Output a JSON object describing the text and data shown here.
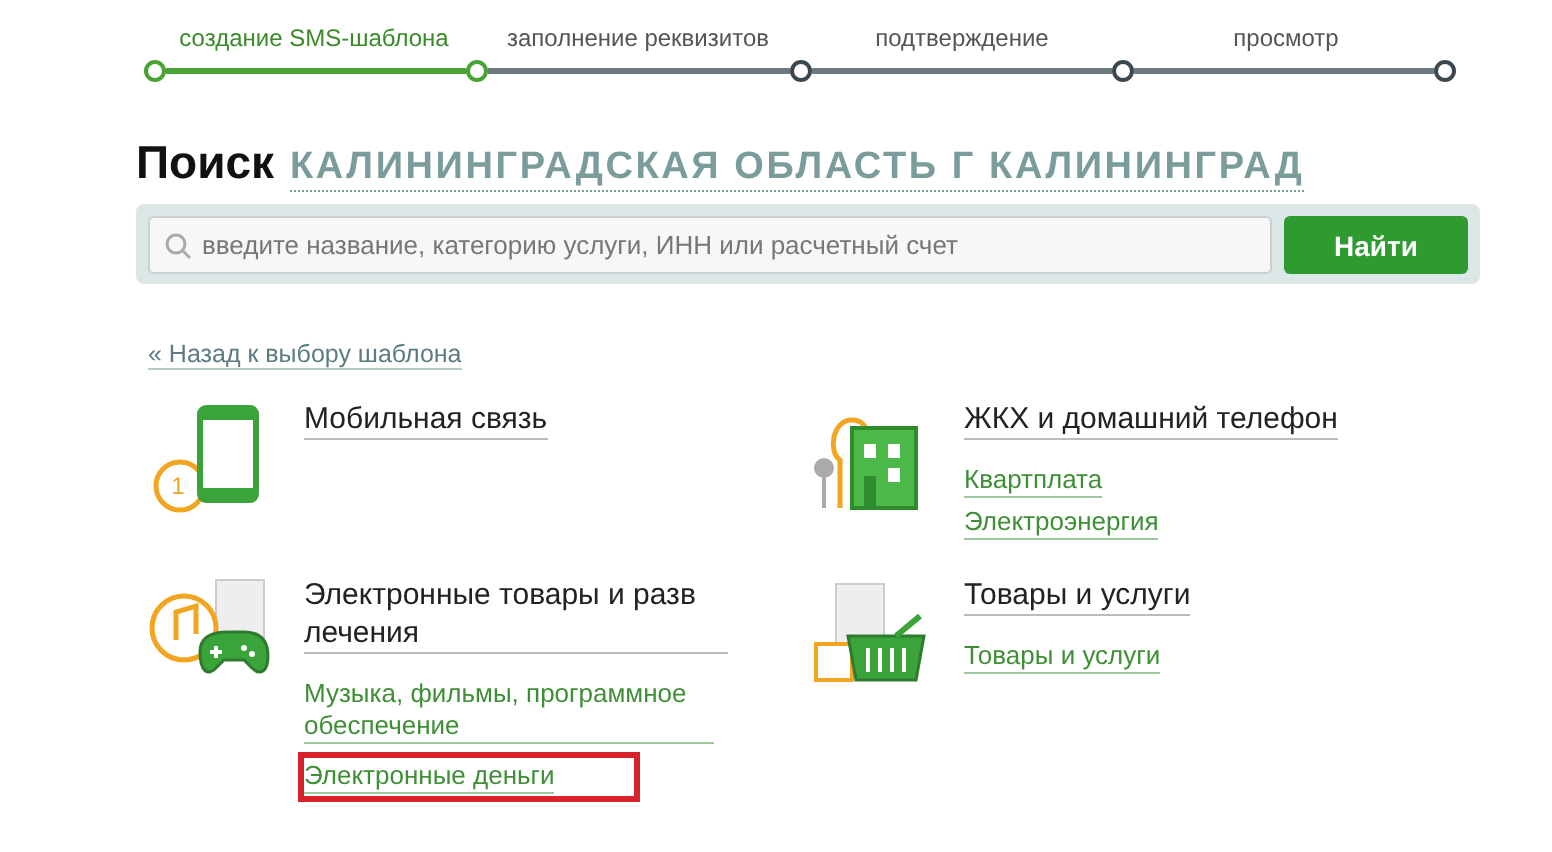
{
  "steps": [
    {
      "label": "создание SMS-шаблона",
      "done": true
    },
    {
      "label": "заполнение реквизитов",
      "done": false
    },
    {
      "label": "подтверждение",
      "done": false
    },
    {
      "label": "просмотр",
      "done": false
    }
  ],
  "search": {
    "title": "Поиск",
    "region": "КАЛИНИНГРАДСКАЯ ОБЛАСТЬ Г КАЛИНИНГРАД",
    "placeholder": "введите название, категорию услуги, ИНН или расчетный счет",
    "button": "Найти"
  },
  "back_link": "« Назад к выбору шаблона",
  "categories": [
    {
      "kind": "mobile",
      "title": "Мобильная связь",
      "badge": "1"
    },
    {
      "kind": "housing",
      "title": "ЖКХ и домашний телефон",
      "links": [
        {
          "label": "Квартплата",
          "highlighted": false
        },
        {
          "label": "Электроэнергия",
          "highlighted": false
        }
      ]
    },
    {
      "kind": "entertainment",
      "title": "Электронные товары и разв лечения",
      "links": [
        {
          "label": "Музыка, фильмы, программное обеспечение",
          "highlighted": false
        },
        {
          "label": "Электронные деньги",
          "highlighted": true
        }
      ]
    },
    {
      "kind": "shopping",
      "title": "Товары и услуги",
      "links": [
        {
          "label": "Товары и услуги",
          "highlighted": false
        }
      ]
    }
  ]
}
